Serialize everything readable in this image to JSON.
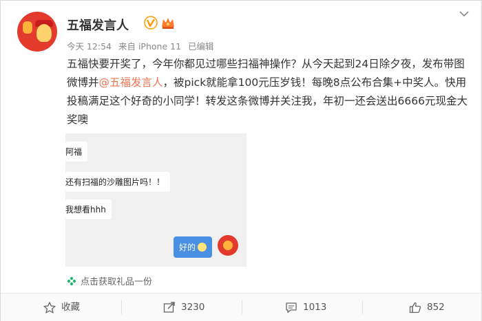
{
  "post": {
    "username": "五福发言人",
    "meta": {
      "time": "今天 12:54",
      "source": "来自 iPhone 11",
      "edited": "已编辑"
    },
    "text": {
      "part1": "五福快要开奖了，今年你都见过哪些扫福神操作？从今天起到24日除夕夜，发布带图微博并",
      "mention": "@五福发言人",
      "part2": "，被pick就能拿100元压岁钱！每晚8点公布合集+中奖人。快用投稿满足这个好奇的小同学！转发这条微博并关注我，年初一还会送出6666元现金大奖噢"
    },
    "image": {
      "messages": [
        "阿福",
        "还有扫福的沙雕图片吗！！",
        "我想看hhh"
      ],
      "reply": "好的"
    },
    "gift_link": "点击获取礼品一份"
  },
  "actions": {
    "favorite": "收藏",
    "repost_count": "3230",
    "comment_count": "1013",
    "like_count": "852"
  },
  "colors": {
    "mention": "#eb7350",
    "verified_badge": "#ff9a00",
    "reply_bubble": "#4a90e2",
    "gift_icon": "#2bb673"
  }
}
